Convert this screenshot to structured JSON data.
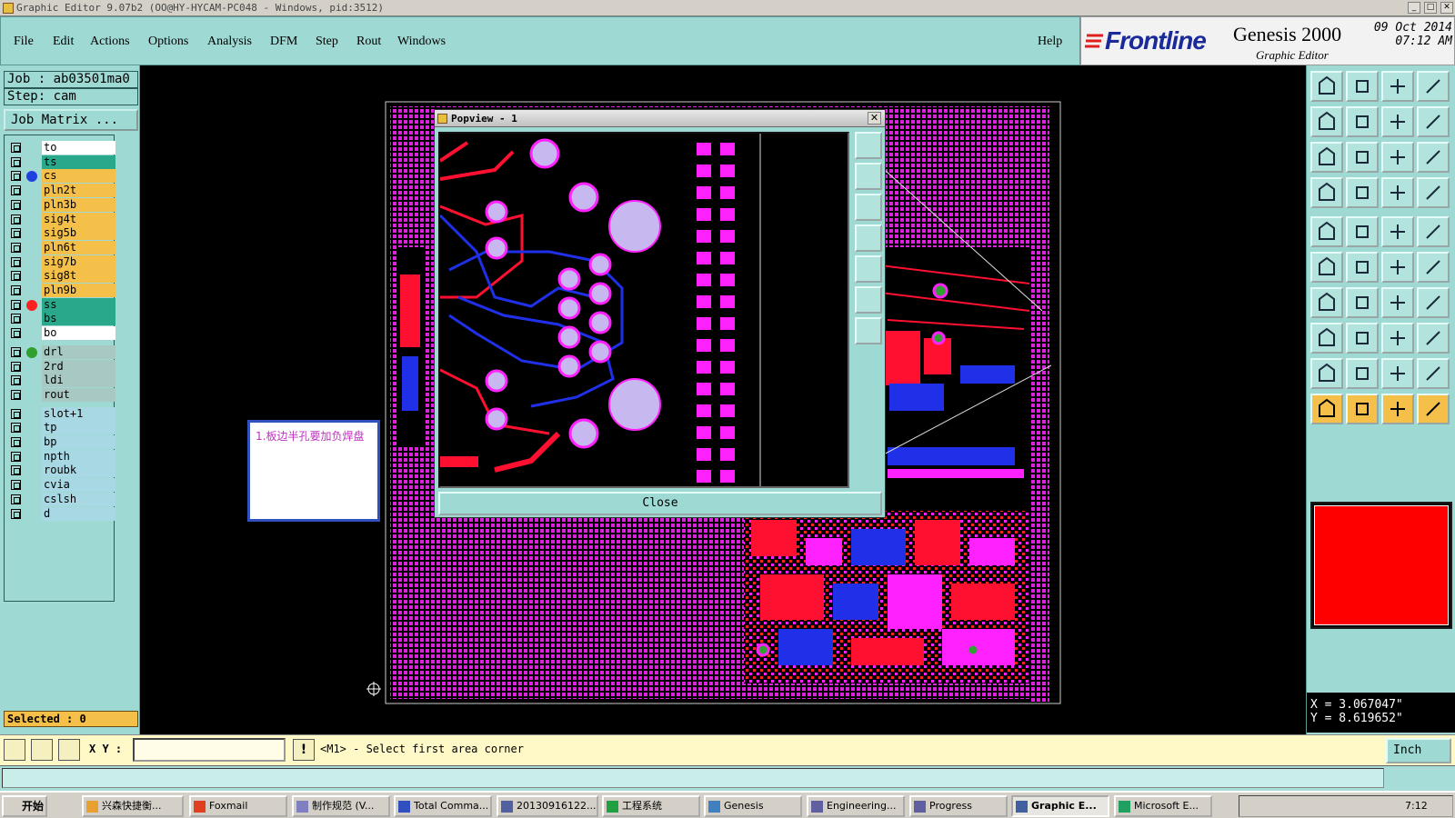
{
  "window": {
    "title": "Graphic Editor 9.07b2 (OO@HY-HYCAM-PC048 - Windows, pid:3512)"
  },
  "menu": {
    "items": [
      "File",
      "Edit",
      "Actions",
      "Options",
      "Analysis",
      "DFM",
      "Step",
      "Rout",
      "Windows"
    ],
    "help": "Help"
  },
  "brand": {
    "logo": "Frontline",
    "product": "Genesis 2000",
    "subtitle": "Graphic Editor",
    "date": "09 Oct 2014",
    "time": "07:12 AM"
  },
  "job": {
    "job_label": "Job : ab03501ma0",
    "step_label": "Step: cam",
    "matrix_button": "Job Matrix ..."
  },
  "layers": [
    {
      "name": "to",
      "bg": "#ffffff",
      "dot": ""
    },
    {
      "name": "ts",
      "bg": "#2aa88c",
      "dot": ""
    },
    {
      "name": "cs",
      "bg": "#f4c04a",
      "dot": "#2040e0"
    },
    {
      "name": "pln2t",
      "bg": "#f4c04a",
      "dot": ""
    },
    {
      "name": "pln3b",
      "bg": "#f4c04a",
      "dot": ""
    },
    {
      "name": "sig4t",
      "bg": "#f4c04a",
      "dot": ""
    },
    {
      "name": "sig5b",
      "bg": "#f4c04a",
      "dot": ""
    },
    {
      "name": "pln6t",
      "bg": "#f4c04a",
      "dot": ""
    },
    {
      "name": "sig7b",
      "bg": "#f4c04a",
      "dot": ""
    },
    {
      "name": "sig8t",
      "bg": "#f4c04a",
      "dot": ""
    },
    {
      "name": "pln9b",
      "bg": "#f4c04a",
      "dot": ""
    },
    {
      "name": "ss",
      "bg": "#2aa88c",
      "dot": "#ff2020"
    },
    {
      "name": "bs",
      "bg": "#2aa88c",
      "dot": ""
    },
    {
      "name": "bo",
      "bg": "#ffffff",
      "dot": ""
    },
    {
      "name": "drl",
      "bg": "#a8c8c4",
      "dot": "#30a030"
    },
    {
      "name": "2rd",
      "bg": "#a8c8c4",
      "dot": ""
    },
    {
      "name": "ldi",
      "bg": "#a8c8c4",
      "dot": ""
    },
    {
      "name": "rout",
      "bg": "#a8c8c4",
      "dot": ""
    },
    {
      "name": "slot+1",
      "bg": "#a8d8e4",
      "dot": ""
    },
    {
      "name": "tp",
      "bg": "#a8d8e4",
      "dot": ""
    },
    {
      "name": "bp",
      "bg": "#a8d8e4",
      "dot": ""
    },
    {
      "name": "npth",
      "bg": "#a8d8e4",
      "dot": ""
    },
    {
      "name": "roubk",
      "bg": "#a8d8e4",
      "dot": ""
    },
    {
      "name": "cvia",
      "bg": "#a8d8e4",
      "dot": ""
    },
    {
      "name": "cslsh",
      "bg": "#a8d8e4",
      "dot": ""
    },
    {
      "name": "d",
      "bg": "#a8d8e4",
      "dot": ""
    }
  ],
  "selected": "Selected : 0",
  "note": "1.板边半孔要加负焊盘",
  "popview": {
    "title": "Popview - 1",
    "close_label": "Close"
  },
  "coords": {
    "x": "X = 3.067047\"",
    "y": "Y = 8.619652\""
  },
  "command": {
    "xy_label": "X Y :",
    "xy_value": "",
    "prompt": "<M1> - Select first area corner",
    "units": "Inch"
  },
  "taskbar": {
    "start": "开始",
    "tasks": [
      "兴森快捷衡...",
      "Foxmail",
      "制作规范 (V...",
      "Total Comma...",
      "20130916122...",
      "工程系统",
      "Genesis",
      "Engineering...",
      "Progress",
      "Graphic E...",
      "Microsoft E..."
    ],
    "clock": "7:12"
  },
  "colors": {
    "panel": "#9fd9d3",
    "layer_active": "#f4c04a",
    "copper_magenta": "#ff22ff",
    "copper_red": "#ff1030",
    "copper_blue": "#2030e8"
  }
}
